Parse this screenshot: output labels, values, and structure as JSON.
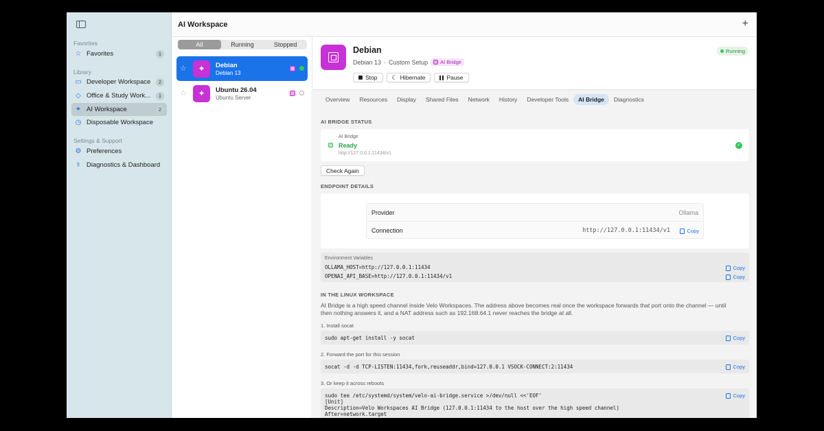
{
  "sidebar": {
    "sections": [
      {
        "label": "Favorites",
        "items": [
          {
            "label": "Favorites",
            "badge": "1",
            "icon": "star-icon"
          }
        ]
      },
      {
        "label": "Library",
        "items": [
          {
            "label": "Developer Workspace",
            "badge": "2",
            "icon": "laptop-icon"
          },
          {
            "label": "Office & Study Work...",
            "badge": "1",
            "icon": "graduation-cap-icon"
          },
          {
            "label": "AI Workspace",
            "badge": "2",
            "icon": "sparkles-icon",
            "selected": true
          },
          {
            "label": "Disposable Workspace",
            "badge": "",
            "icon": "timer-icon"
          }
        ]
      },
      {
        "label": "Settings & Support",
        "items": [
          {
            "label": "Preferences",
            "badge": "",
            "icon": "gear-icon"
          },
          {
            "label": "Diagnostics & Dashboard",
            "badge": "",
            "icon": "stethoscope-icon"
          }
        ]
      }
    ]
  },
  "header": {
    "title": "AI Workspace"
  },
  "filter": {
    "options": [
      "All",
      "Running",
      "Stopped"
    ],
    "selected": "All"
  },
  "vms": [
    {
      "name": "Debian",
      "sub": "Debian 13",
      "selected": true,
      "status": "running"
    },
    {
      "name": "Ubuntu 26.04",
      "sub": "Ubuntu Server",
      "selected": false,
      "status": "stopped"
    }
  ],
  "detail": {
    "name": "Debian",
    "os": "Debian 13",
    "sep": "·",
    "setup": "Custom Setup",
    "bridge_label": "AI Bridge",
    "status": "Running",
    "actions": {
      "stop": "Stop",
      "hibernate": "Hibernate",
      "pause": "Pause"
    },
    "tabs": [
      "Overview",
      "Resources",
      "Display",
      "Shared Files",
      "Network",
      "History",
      "Developer Tools",
      "AI Bridge",
      "Diagnostics"
    ],
    "active_tab": "AI Bridge"
  },
  "bridge_status": {
    "header": "AI BRIDGE STATUS",
    "label": "AI Bridge",
    "state": "Ready",
    "url": "http://127.0.0.1:11434/v1",
    "check_again": "Check Again"
  },
  "endpoint": {
    "header": "ENDPOINT DETAILS",
    "provider_label": "Provider",
    "provider_value": "Ollama",
    "connection_label": "Connection",
    "connection_value": "http://127.0.0.1:11434/v1",
    "copy": "Copy"
  },
  "env": {
    "title": "Environment Variables",
    "lines": [
      "OLLAMA_HOST=http://127.0.0.1:11434",
      "OPENAI_API_BASE=http://127.0.0.1:11434/v1"
    ],
    "copy": "Copy"
  },
  "linux": {
    "header": "IN THE LINUX WORKSPACE",
    "para1": "AI Bridge is a high speed channel inside Velo Workspaces. The address above becomes real once the workspace forwards that port onto the channel — until",
    "para2": "then nothing answers it, and a NAT address such as 192.168.64.1 never reaches the bridge at all.",
    "steps": [
      {
        "label": "1. Install socat",
        "code": [
          "sudo apt-get install -y socat"
        ]
      },
      {
        "label": "2. Forward the port for this session",
        "code": [
          "socat -d -d TCP-LISTEN:11434,fork,reuseaddr,bind=127.0.0.1 VSOCK-CONNECT:2:11434"
        ]
      },
      {
        "label": "3. Or keep it across reboots",
        "code": [
          "sudo tee /etc/systemd/system/velo-ai-bridge.service >/dev/null <<'EOF'",
          "[Unit]",
          "Description=Velo Workspaces AI Bridge (127.0.0.1:11434 to the host over the high speed channel)",
          "After=network.target"
        ]
      }
    ],
    "copy": "Copy"
  }
}
